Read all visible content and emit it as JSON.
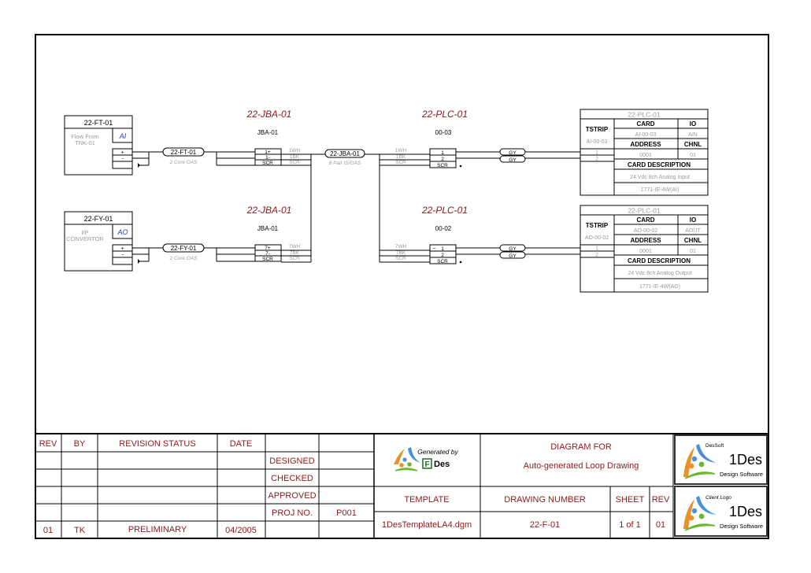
{
  "loops": [
    {
      "device": {
        "tag": "22-FT-01",
        "description_lines": [
          "Flow From",
          "TNK-01"
        ],
        "io_type": "AI",
        "terminals": [
          "+",
          "-",
          ""
        ]
      },
      "field_cable": {
        "tag": "22-FT-01",
        "type": "2 Core OAS"
      },
      "jb": {
        "title": "22-JBA-01",
        "name": "JBA-01",
        "terminals": [
          "1+",
          "1-",
          "SCR"
        ],
        "cores_out": [
          "1WH",
          "1BK",
          "SCR"
        ]
      },
      "plc": {
        "title": "22-PLC-01",
        "name": "00-03",
        "cores_in": [
          "1WH",
          "1BK",
          "SCR"
        ],
        "terminals": [
          "1",
          "2",
          "SCR"
        ],
        "prefix_symbol": "",
        "wires": [
          "GY",
          "GY"
        ]
      },
      "card": {
        "title": "22-PLC-01",
        "tstrip_label": "TSTRIP",
        "tstrip_value": "AI-00-03",
        "tstrip_terminals": [
          "1",
          "2"
        ],
        "card_label": "CARD",
        "card_value": "AI-00-03",
        "io_label": "IO",
        "io_value": "AIN",
        "address_label": "ADDRESS",
        "address_value": "0001",
        "chnl_label": "CHNL",
        "chnl_value": "01",
        "desc_label": "CARD DESCRIPTION",
        "desc_value": "24 Vdc 8ch Analog  Input",
        "model": "1771-IE-4W(AI)"
      }
    },
    {
      "device": {
        "tag": "22-FY-01",
        "description_lines": [
          "I/P",
          "CONVERTOR"
        ],
        "io_type": "AO",
        "terminals": [
          "+",
          "-",
          ""
        ]
      },
      "field_cable": {
        "tag": "22-FY-01",
        "type": "2 Core OAS"
      },
      "jb": {
        "title": "22-JBA-01",
        "name": "JBA-01",
        "terminals": [
          "7+",
          "7-",
          "SCR"
        ],
        "cores_out": [
          "7WH",
          "7BK",
          "SCR"
        ]
      },
      "plc": {
        "title": "22-PLC-01",
        "name": "00-02",
        "cores_in": [
          "7WH",
          "7BK",
          "SCR"
        ],
        "terminals": [
          "1",
          "2",
          "SCR"
        ],
        "prefix_symbol": "~",
        "wires": [
          "GY",
          "GY"
        ]
      },
      "card": {
        "title": "22-PLC-01",
        "tstrip_label": "TSTRIP",
        "tstrip_value": "AO-00-02",
        "tstrip_terminals": [
          "1",
          "2"
        ],
        "card_label": "CARD",
        "card_value": "AO-00-02",
        "io_label": "IO",
        "io_value": "AOUT",
        "address_label": "ADDRESS",
        "address_value": "0001",
        "chnl_label": "CHNL",
        "chnl_value": "01",
        "desc_label": "CARD DESCRIPTION",
        "desc_value": "24 Vdc 8ch Analog  Output",
        "model": "1771-IE-4W(AO)"
      }
    }
  ],
  "multipair_cable": {
    "tag": "22-JBA-01",
    "type": "8 Pair IS/OAS"
  },
  "title_block": {
    "revision_headers": {
      "rev": "REV",
      "by": "BY",
      "status": "REVISION STATUS",
      "date": "DATE"
    },
    "revision_rows": [
      {
        "rev": "",
        "by": "",
        "status": "",
        "date": ""
      },
      {
        "rev": "",
        "by": "",
        "status": "",
        "date": ""
      },
      {
        "rev": "",
        "by": "",
        "status": "",
        "date": ""
      },
      {
        "rev": "",
        "by": "",
        "status": "",
        "date": ""
      },
      {
        "rev": "01",
        "by": "TK",
        "status": "PRELIMINARY",
        "date": "04/2005"
      }
    ],
    "signoff": [
      {
        "label": "",
        "value": ""
      },
      {
        "label": "DESIGNED",
        "value": ""
      },
      {
        "label": "CHECKED",
        "value": ""
      },
      {
        "label": "APPROVED",
        "value": ""
      },
      {
        "label": "PROJ NO.",
        "value": "P001"
      },
      {
        "label": "",
        "value": ""
      }
    ],
    "generated_by": "Generated by",
    "generator_logo_letter": "F",
    "generator_name": "Des",
    "diagram_for_label": "DIAGRAM FOR",
    "diagram_title": "Auto-generated Loop Drawing",
    "template_label": "TEMPLATE",
    "template_value": "1DesTemplateLA4.dgm",
    "drawing_number_label": "DRAWING NUMBER",
    "drawing_number_value": "22-F-01",
    "sheet_label": "SHEET",
    "sheet_value": "1 of 1",
    "rev_label": "REV",
    "rev_value": "01",
    "company_logo": {
      "caption": "DesSoft",
      "brand": "1Des",
      "tagline": "Design Software"
    },
    "client_logo": {
      "caption": "Client Logo",
      "brand": "1Des",
      "tagline": "Design Software"
    }
  },
  "colors": {
    "title_red": "#8b1a1a",
    "faint_gray": "#9a9a9a",
    "io_blue": "#2a3fb0",
    "logo_orange": "#e8902a",
    "logo_blue": "#4a90d9",
    "logo_green": "#6ab82e",
    "generator_green": "#1f6b1f"
  }
}
